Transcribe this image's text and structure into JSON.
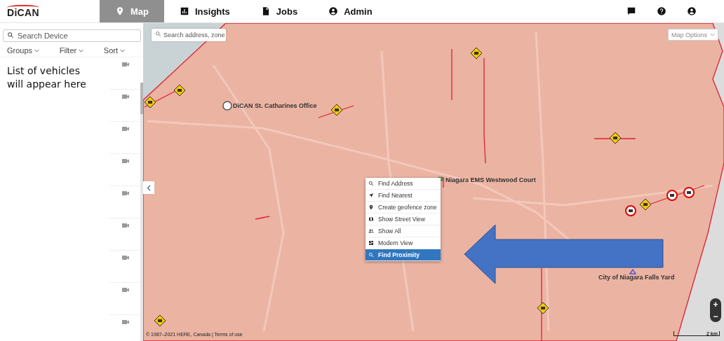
{
  "header": {
    "logo": "DiCAN",
    "tabs": [
      {
        "label": "Map",
        "kind": "pin",
        "selected": true
      },
      {
        "label": "Insights",
        "kind": "chart",
        "selected": false
      },
      {
        "label": "Jobs",
        "kind": "doc",
        "selected": false
      },
      {
        "label": "Admin",
        "kind": "user",
        "selected": false
      }
    ]
  },
  "sidebar": {
    "search": {
      "placeholder": "Search Device"
    },
    "filters": [
      "Groups",
      "Filter",
      "Sort"
    ],
    "empty_message": "List of vehicles will appear here",
    "vehicle_rows": [
      {
        "kind": "camera"
      },
      {
        "kind": "camera"
      },
      {
        "kind": "camera"
      },
      {
        "kind": "camera"
      },
      {
        "kind": "camera"
      },
      {
        "kind": "camera"
      },
      {
        "kind": "camera"
      },
      {
        "kind": "camera"
      },
      {
        "kind": "camera"
      }
    ]
  },
  "map": {
    "search": {
      "placeholder": "Search address, zone"
    },
    "options": "Map Options",
    "places": [
      {
        "label": "DiCAN St. Catharines Office",
        "kind": "office"
      },
      {
        "label": "Niagara EMS Westwood Court",
        "kind": "depot"
      },
      {
        "label": "City of Niagara Falls Yard",
        "kind": "yard"
      }
    ],
    "context_menu": [
      {
        "label": "Find Address",
        "kind": "search",
        "selected": false
      },
      {
        "label": "Find Nearest",
        "kind": "nav",
        "selected": false
      },
      {
        "label": "Create geofence zone",
        "kind": "pin",
        "selected": false
      },
      {
        "label": "Show Street View",
        "kind": "map",
        "selected": false
      },
      {
        "label": "Show All",
        "kind": "people",
        "selected": false
      },
      {
        "label": "Modern View",
        "kind": "dash",
        "selected": false
      },
      {
        "label": "Find Proximity",
        "kind": "search",
        "selected": true
      }
    ],
    "zoom": [
      "+",
      "−"
    ],
    "scale": "2 km",
    "attribution": "© 1987–2021 HERE, Canada | Terms of use"
  }
}
